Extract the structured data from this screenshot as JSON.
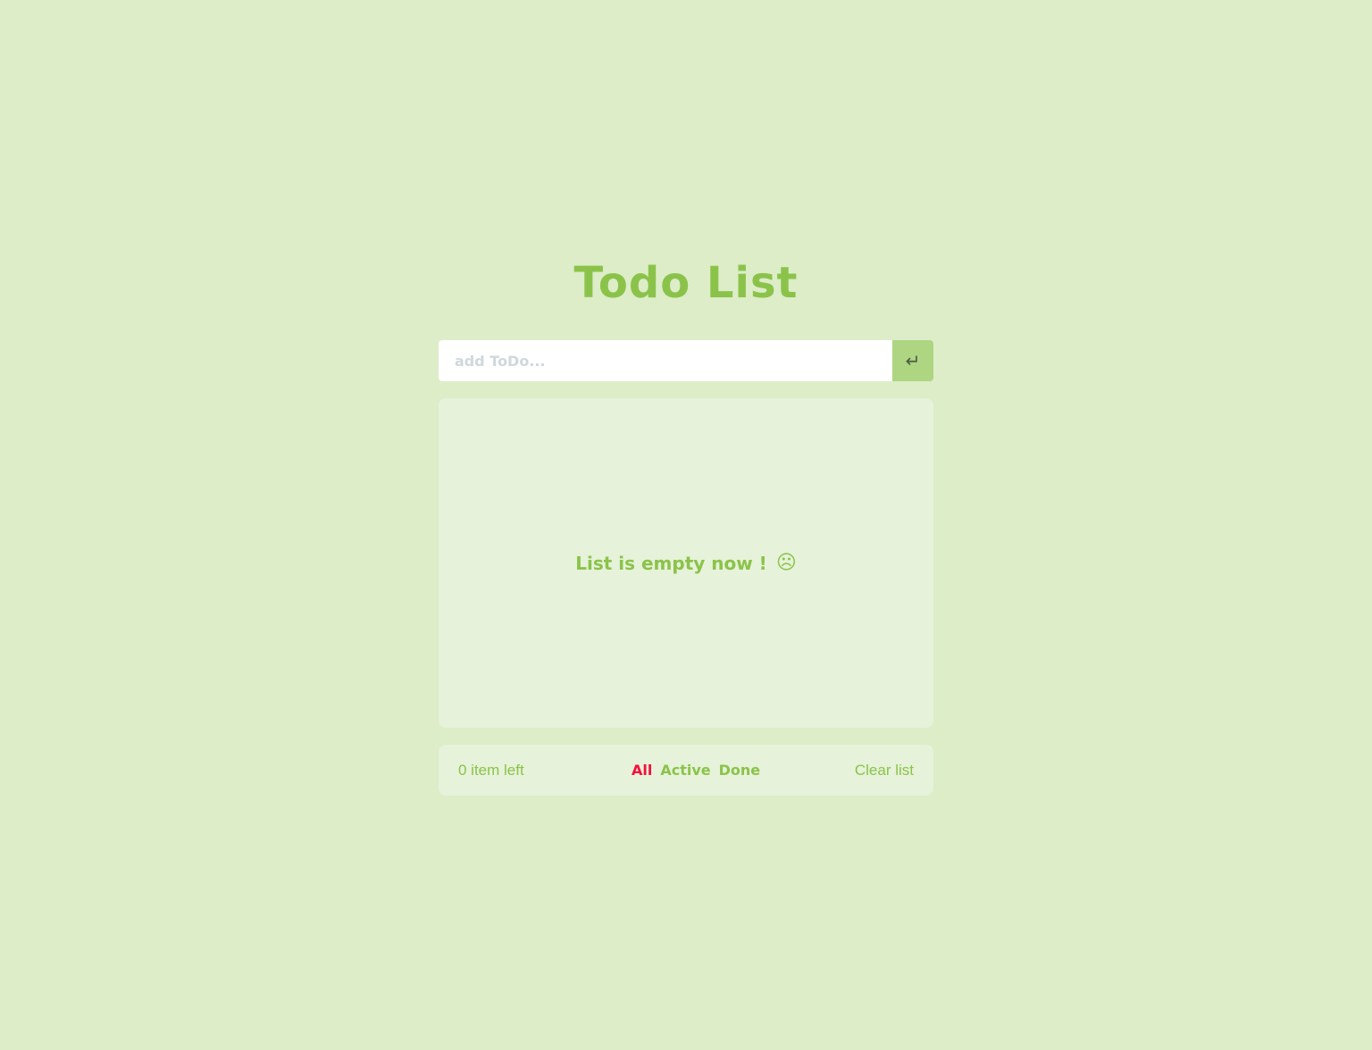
{
  "header": {
    "title": "Todo List"
  },
  "input": {
    "placeholder": "add ToDo...",
    "value": "",
    "submit_icon": "enter-return-icon",
    "submit_glyph": "↵"
  },
  "list": {
    "empty_message": "List is empty now !",
    "empty_icon": "sad-face-icon",
    "empty_glyph": "☹"
  },
  "footer": {
    "items_left": "0 item left",
    "filters": [
      {
        "label": "All",
        "selected": true
      },
      {
        "label": "Active",
        "selected": false
      },
      {
        "label": "Done",
        "selected": false
      }
    ],
    "clear_label": "Clear list"
  },
  "colors": {
    "background": "#dcedc8",
    "accent": "#8bc34a",
    "active_filter": "#f50f3c",
    "panel": "#e6f2d9",
    "button": "#aed581"
  }
}
